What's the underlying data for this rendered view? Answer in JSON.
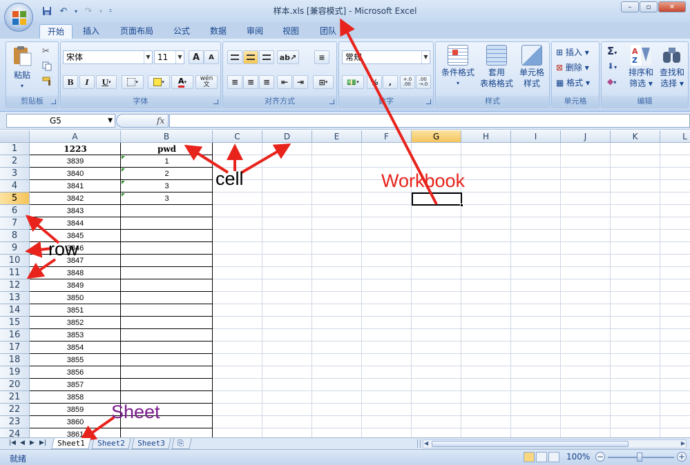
{
  "window": {
    "title": "样本.xls  [兼容模式] - Microsoft Excel",
    "min": "–",
    "max": "▫",
    "close": "✕"
  },
  "ribbon_tabs": [
    "开始",
    "插入",
    "页面布局",
    "公式",
    "数据",
    "审阅",
    "视图",
    "团队"
  ],
  "ribbon": {
    "clipboard": {
      "paste": "粘贴",
      "label": "剪贴板"
    },
    "font": {
      "name": "宋体",
      "size": "11",
      "grow": "A",
      "shrink": "A",
      "bold": "B",
      "italic": "I",
      "underline": "U",
      "phonetic": "wén\n文",
      "label": "字体"
    },
    "alignment": {
      "label": "对齐方式"
    },
    "number": {
      "format": "常规",
      "percent": "%",
      "comma": ",",
      "inc_decimal": "+.0\n.00",
      "dec_decimal": ".00\n→.0",
      "label": "数字"
    },
    "styles": {
      "conditional": "条件格式",
      "table_1": "套用",
      "table_2": "表格格式",
      "cell_1": "单元格",
      "cell_2": "样式",
      "label": "样式"
    },
    "cells": {
      "insert": "插入",
      "delete": "删除",
      "format": "格式",
      "label": "单元格"
    },
    "editing": {
      "sigma": "Σ",
      "sort_1": "排序和",
      "sort_2": "筛选",
      "find_1": "查找和",
      "find_2": "选择",
      "label": "编辑"
    }
  },
  "formula_bar": {
    "name_box": "G5",
    "fx": "fx",
    "content": ""
  },
  "grid": {
    "columns": [
      "A",
      "B",
      "C",
      "D",
      "E",
      "F",
      "G",
      "H",
      "I",
      "J",
      "K",
      "L"
    ],
    "selected_column": "G",
    "selected_row": "5",
    "rows": [
      {
        "n": "1",
        "a": "1223",
        "b": "pwd"
      },
      {
        "n": "2",
        "a": "3839",
        "b": "1"
      },
      {
        "n": "3",
        "a": "3840",
        "b": "2"
      },
      {
        "n": "4",
        "a": "3841",
        "b": "3"
      },
      {
        "n": "5",
        "a": "3842",
        "b": "3"
      },
      {
        "n": "6",
        "a": "3843",
        "b": ""
      },
      {
        "n": "7",
        "a": "3844",
        "b": ""
      },
      {
        "n": "8",
        "a": "3845",
        "b": ""
      },
      {
        "n": "9",
        "a": "3846",
        "b": ""
      },
      {
        "n": "10",
        "a": "3847",
        "b": ""
      },
      {
        "n": "11",
        "a": "3848",
        "b": ""
      },
      {
        "n": "12",
        "a": "3849",
        "b": ""
      },
      {
        "n": "13",
        "a": "3850",
        "b": ""
      },
      {
        "n": "14",
        "a": "3851",
        "b": ""
      },
      {
        "n": "15",
        "a": "3852",
        "b": ""
      },
      {
        "n": "16",
        "a": "3853",
        "b": ""
      },
      {
        "n": "17",
        "a": "3854",
        "b": ""
      },
      {
        "n": "18",
        "a": "3855",
        "b": ""
      },
      {
        "n": "19",
        "a": "3856",
        "b": ""
      },
      {
        "n": "20",
        "a": "3857",
        "b": ""
      },
      {
        "n": "21",
        "a": "3858",
        "b": ""
      },
      {
        "n": "22",
        "a": "3859",
        "b": ""
      },
      {
        "n": "23",
        "a": "3860",
        "b": ""
      },
      {
        "n": "24",
        "a": "3861",
        "b": ""
      }
    ]
  },
  "sheets": [
    "Sheet1",
    "Sheet2",
    "Sheet3"
  ],
  "active_sheet": "Sheet1",
  "status": {
    "text": "就绪",
    "zoom": "100%"
  },
  "annotations": {
    "cell": "cell",
    "row": "row",
    "sheet": "Sheet",
    "workbook": "Workbook"
  },
  "colors": {
    "arrow": "#e8231c",
    "workbook_text": "#e8231c",
    "sheet_text": "#7a1b8c",
    "selected_header": "#f5c55d"
  }
}
